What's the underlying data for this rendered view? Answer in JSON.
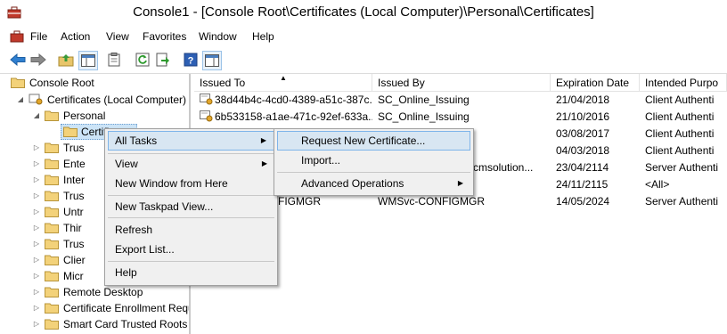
{
  "window": {
    "title": "Console1 - [Console Root\\Certificates (Local Computer)\\Personal\\Certificates]",
    "app_icon": "mmc-toolbox-icon"
  },
  "menubar": {
    "items": [
      "File",
      "Action",
      "View",
      "Favorites",
      "Window",
      "Help"
    ]
  },
  "toolbar": {
    "buttons": [
      "back-icon",
      "forward-icon",
      "up-folder-icon",
      "show-tree-icon",
      "properties-icon",
      "refresh-icon",
      "export-list-icon",
      "help-icon",
      "show-action-pane-icon"
    ]
  },
  "tree": {
    "items": [
      {
        "label": "Console Root"
      },
      {
        "label": "Certificates (Local Computer)"
      },
      {
        "label": "Personal"
      },
      {
        "label": "Certificates"
      },
      {
        "label": "Trus"
      },
      {
        "label": "Ente"
      },
      {
        "label": "Inter"
      },
      {
        "label": "Trus"
      },
      {
        "label": "Untr"
      },
      {
        "label": "Thir"
      },
      {
        "label": "Trus"
      },
      {
        "label": "Clier"
      },
      {
        "label": "Micr"
      },
      {
        "label": "Remote Desktop"
      },
      {
        "label": "Certificate Enrollment Requ"
      },
      {
        "label": "Smart Card Trusted Roots"
      }
    ]
  },
  "list": {
    "columns": [
      "Issued To",
      "Issued By",
      "Expiration Date",
      "Intended Purpo"
    ],
    "rows": [
      {
        "issued_to": "38d44b4c-4cd0-4389-a51c-387c...",
        "issued_by": "SC_Online_Issuing",
        "expiration": "21/04/2018",
        "purpose": "Client Authenti"
      },
      {
        "issued_to": "6b533158-a1ae-471c-92ef-633a...",
        "issued_by": "SC_Online_Issuing",
        "expiration": "21/10/2016",
        "purpose": "Client Authenti"
      },
      {
        "issued_to": "",
        "issued_by": "",
        "expiration": "03/08/2017",
        "purpose": "Client Authenti"
      },
      {
        "issued_to": "",
        "issued_by": "",
        "expiration": "04/03/2018",
        "purpose": "Client Authenti"
      },
      {
        "issued_to": "",
        "issued_by": "ccmsolution...",
        "expiration": "23/04/2114",
        "purpose": "Server Authenti"
      },
      {
        "issued_to": "",
        "issued_by": "",
        "expiration": "24/11/2115",
        "purpose": "<All>"
      },
      {
        "issued_to": "FIGMGR",
        "issued_by": "WMSvc-CONFIGMGR",
        "expiration": "14/05/2024",
        "purpose": "Server Authenti"
      }
    ]
  },
  "context_menu": {
    "all_tasks": "All Tasks",
    "view": "View",
    "new_window": "New Window from Here",
    "new_taskpad": "New Taskpad View...",
    "refresh": "Refresh",
    "export_list": "Export List...",
    "help": "Help"
  },
  "submenu": {
    "request_new": "Request New Certificate...",
    "import": "Import...",
    "advanced": "Advanced Operations"
  },
  "colors": {
    "highlight_bg": "#d8e6f2",
    "highlight_border": "#7eb4ea",
    "menu_bg": "#f0f0f0"
  }
}
